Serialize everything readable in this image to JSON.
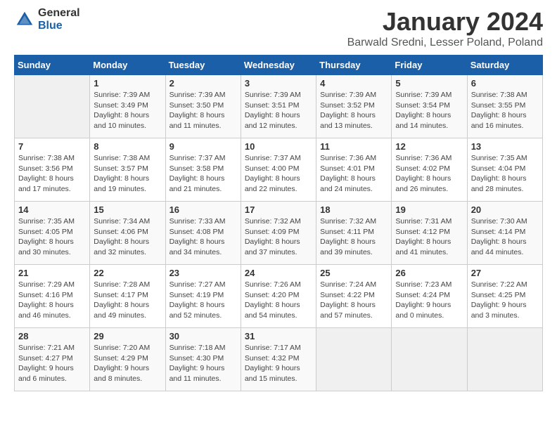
{
  "logo": {
    "general": "General",
    "blue": "Blue"
  },
  "title": "January 2024",
  "location": "Barwald Sredni, Lesser Poland, Poland",
  "days_header": [
    "Sunday",
    "Monday",
    "Tuesday",
    "Wednesday",
    "Thursday",
    "Friday",
    "Saturday"
  ],
  "weeks": [
    [
      {
        "num": "",
        "info": ""
      },
      {
        "num": "1",
        "info": "Sunrise: 7:39 AM\nSunset: 3:49 PM\nDaylight: 8 hours\nand 10 minutes."
      },
      {
        "num": "2",
        "info": "Sunrise: 7:39 AM\nSunset: 3:50 PM\nDaylight: 8 hours\nand 11 minutes."
      },
      {
        "num": "3",
        "info": "Sunrise: 7:39 AM\nSunset: 3:51 PM\nDaylight: 8 hours\nand 12 minutes."
      },
      {
        "num": "4",
        "info": "Sunrise: 7:39 AM\nSunset: 3:52 PM\nDaylight: 8 hours\nand 13 minutes."
      },
      {
        "num": "5",
        "info": "Sunrise: 7:39 AM\nSunset: 3:54 PM\nDaylight: 8 hours\nand 14 minutes."
      },
      {
        "num": "6",
        "info": "Sunrise: 7:38 AM\nSunset: 3:55 PM\nDaylight: 8 hours\nand 16 minutes."
      }
    ],
    [
      {
        "num": "7",
        "info": "Sunrise: 7:38 AM\nSunset: 3:56 PM\nDaylight: 8 hours\nand 17 minutes."
      },
      {
        "num": "8",
        "info": "Sunrise: 7:38 AM\nSunset: 3:57 PM\nDaylight: 8 hours\nand 19 minutes."
      },
      {
        "num": "9",
        "info": "Sunrise: 7:37 AM\nSunset: 3:58 PM\nDaylight: 8 hours\nand 21 minutes."
      },
      {
        "num": "10",
        "info": "Sunrise: 7:37 AM\nSunset: 4:00 PM\nDaylight: 8 hours\nand 22 minutes."
      },
      {
        "num": "11",
        "info": "Sunrise: 7:36 AM\nSunset: 4:01 PM\nDaylight: 8 hours\nand 24 minutes."
      },
      {
        "num": "12",
        "info": "Sunrise: 7:36 AM\nSunset: 4:02 PM\nDaylight: 8 hours\nand 26 minutes."
      },
      {
        "num": "13",
        "info": "Sunrise: 7:35 AM\nSunset: 4:04 PM\nDaylight: 8 hours\nand 28 minutes."
      }
    ],
    [
      {
        "num": "14",
        "info": "Sunrise: 7:35 AM\nSunset: 4:05 PM\nDaylight: 8 hours\nand 30 minutes."
      },
      {
        "num": "15",
        "info": "Sunrise: 7:34 AM\nSunset: 4:06 PM\nDaylight: 8 hours\nand 32 minutes."
      },
      {
        "num": "16",
        "info": "Sunrise: 7:33 AM\nSunset: 4:08 PM\nDaylight: 8 hours\nand 34 minutes."
      },
      {
        "num": "17",
        "info": "Sunrise: 7:32 AM\nSunset: 4:09 PM\nDaylight: 8 hours\nand 37 minutes."
      },
      {
        "num": "18",
        "info": "Sunrise: 7:32 AM\nSunset: 4:11 PM\nDaylight: 8 hours\nand 39 minutes."
      },
      {
        "num": "19",
        "info": "Sunrise: 7:31 AM\nSunset: 4:12 PM\nDaylight: 8 hours\nand 41 minutes."
      },
      {
        "num": "20",
        "info": "Sunrise: 7:30 AM\nSunset: 4:14 PM\nDaylight: 8 hours\nand 44 minutes."
      }
    ],
    [
      {
        "num": "21",
        "info": "Sunrise: 7:29 AM\nSunset: 4:16 PM\nDaylight: 8 hours\nand 46 minutes."
      },
      {
        "num": "22",
        "info": "Sunrise: 7:28 AM\nSunset: 4:17 PM\nDaylight: 8 hours\nand 49 minutes."
      },
      {
        "num": "23",
        "info": "Sunrise: 7:27 AM\nSunset: 4:19 PM\nDaylight: 8 hours\nand 52 minutes."
      },
      {
        "num": "24",
        "info": "Sunrise: 7:26 AM\nSunset: 4:20 PM\nDaylight: 8 hours\nand 54 minutes."
      },
      {
        "num": "25",
        "info": "Sunrise: 7:24 AM\nSunset: 4:22 PM\nDaylight: 8 hours\nand 57 minutes."
      },
      {
        "num": "26",
        "info": "Sunrise: 7:23 AM\nSunset: 4:24 PM\nDaylight: 9 hours\nand 0 minutes."
      },
      {
        "num": "27",
        "info": "Sunrise: 7:22 AM\nSunset: 4:25 PM\nDaylight: 9 hours\nand 3 minutes."
      }
    ],
    [
      {
        "num": "28",
        "info": "Sunrise: 7:21 AM\nSunset: 4:27 PM\nDaylight: 9 hours\nand 6 minutes."
      },
      {
        "num": "29",
        "info": "Sunrise: 7:20 AM\nSunset: 4:29 PM\nDaylight: 9 hours\nand 8 minutes."
      },
      {
        "num": "30",
        "info": "Sunrise: 7:18 AM\nSunset: 4:30 PM\nDaylight: 9 hours\nand 11 minutes."
      },
      {
        "num": "31",
        "info": "Sunrise: 7:17 AM\nSunset: 4:32 PM\nDaylight: 9 hours\nand 15 minutes."
      },
      {
        "num": "",
        "info": ""
      },
      {
        "num": "",
        "info": ""
      },
      {
        "num": "",
        "info": ""
      }
    ]
  ]
}
